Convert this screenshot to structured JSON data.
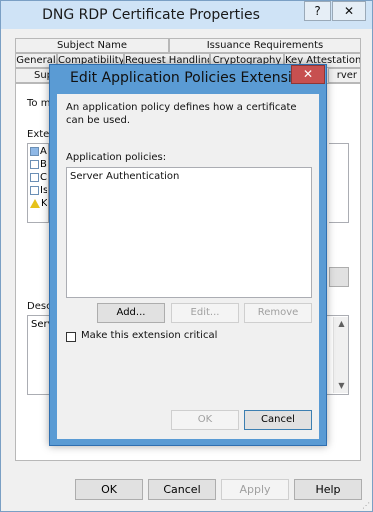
{
  "window": {
    "title": "DNG RDP Certificate Properties",
    "help_button": "?",
    "close_button": "✕"
  },
  "tabs": {
    "row1": [
      "Subject Name",
      "Issuance Requirements"
    ],
    "row2": [
      "General",
      "Compatibility",
      "Request Handling",
      "Cryptography",
      "Key Attestation"
    ],
    "row3_left": "Sup",
    "row3_right": "rver"
  },
  "background": {
    "intro_text": "To m",
    "extensions_label": "Exter",
    "list_items": [
      "A",
      "B",
      "C",
      "Is",
      "K"
    ],
    "description_label": "Desc",
    "description_value": "Serv"
  },
  "buttons": {
    "ok": "OK",
    "cancel": "Cancel",
    "apply": "Apply",
    "help": "Help"
  },
  "dialog": {
    "title": "Edit Application Policies Extension",
    "close_button": "✕",
    "description": "An application policy defines how a certificate can be used.",
    "policies_label": "Application policies:",
    "policies": [
      "Server Authentication"
    ],
    "add_button": "Add...",
    "edit_button": "Edit...",
    "remove_button": "Remove",
    "critical_checkbox_label": "Make this extension critical",
    "critical_checked": false,
    "ok_button": "OK",
    "cancel_button": "Cancel"
  },
  "colors": {
    "titlebar": "#cfe3f6",
    "dialog_frame": "#5a9bd4",
    "close_red": "#c75050",
    "face": "#f0f0f0"
  }
}
